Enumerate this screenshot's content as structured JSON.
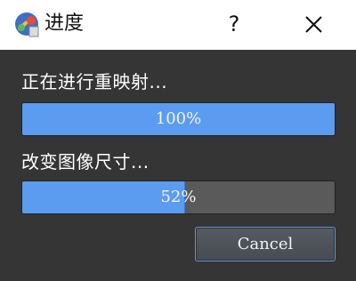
{
  "window": {
    "title": "进度",
    "help_label": "?",
    "app_icon": "app-logo-icon",
    "close_icon": "close-icon"
  },
  "tasks": [
    {
      "label": "正在进行重映射...",
      "progress_text": "100%",
      "progress_value": 100
    },
    {
      "label": "改变图像尺寸...",
      "progress_text": "52%",
      "progress_value": 52
    }
  ],
  "actions": {
    "cancel_label": "Cancel"
  },
  "colors": {
    "background": "#353535",
    "titlebar": "#ffffff",
    "progress_fill": "#5b9cf0",
    "progress_track": "#5a5a5a",
    "button_border": "#6a95d6"
  }
}
